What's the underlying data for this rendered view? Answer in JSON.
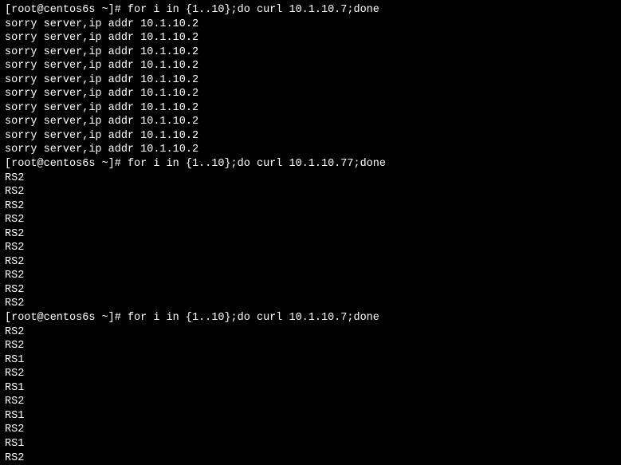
{
  "blocks": [
    {
      "prompt": "[root@centos6s ~]# ",
      "command": "for i in {1..10};do curl 10.1.10.7;done",
      "output": [
        "sorry server,ip addr 10.1.10.2",
        "sorry server,ip addr 10.1.10.2",
        "sorry server,ip addr 10.1.10.2",
        "sorry server,ip addr 10.1.10.2",
        "sorry server,ip addr 10.1.10.2",
        "sorry server,ip addr 10.1.10.2",
        "sorry server,ip addr 10.1.10.2",
        "sorry server,ip addr 10.1.10.2",
        "sorry server,ip addr 10.1.10.2",
        "sorry server,ip addr 10.1.10.2"
      ]
    },
    {
      "prompt": "[root@centos6s ~]# ",
      "command": "for i in {1..10};do curl 10.1.10.77;done",
      "output": [
        "RS2",
        "RS2",
        "RS2",
        "RS2",
        "RS2",
        "RS2",
        "RS2",
        "RS2",
        "RS2",
        "RS2"
      ]
    },
    {
      "prompt": "[root@centos6s ~]# ",
      "command": "for i in {1..10};do curl 10.1.10.7;done",
      "output": [
        "RS2",
        "RS2",
        "RS1",
        "RS2",
        "RS1",
        "RS2",
        "RS1",
        "RS2",
        "RS1",
        "RS2"
      ]
    }
  ]
}
